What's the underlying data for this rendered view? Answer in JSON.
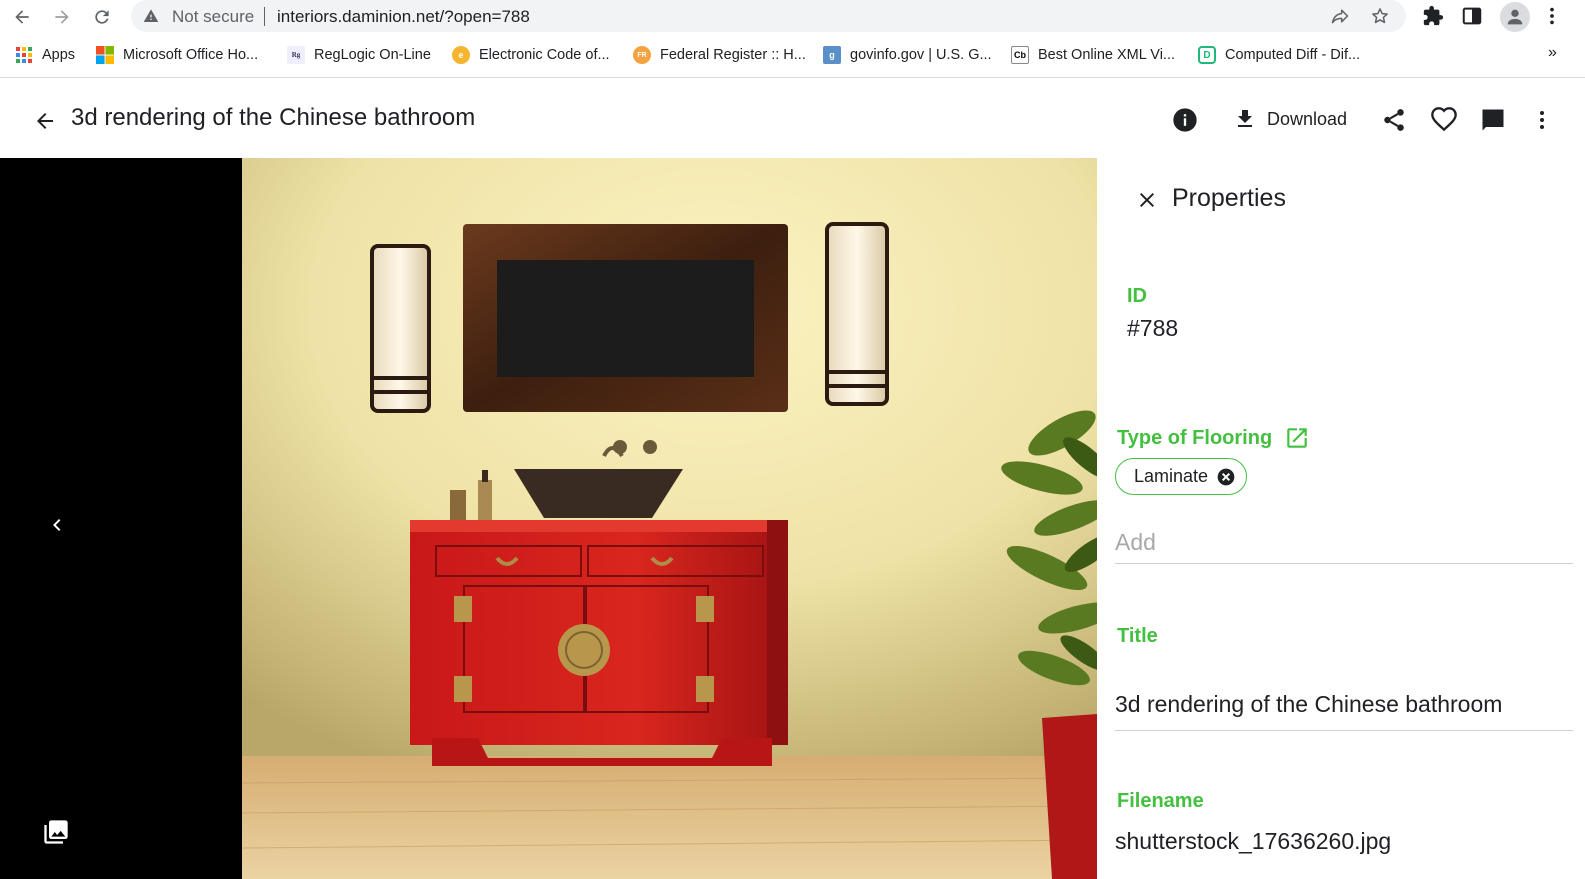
{
  "browser": {
    "security_label": "Not secure",
    "url": "interiors.daminion.net/?open=788",
    "bookmarks": [
      {
        "label": "Apps",
        "icon": "apps-grid-icon"
      },
      {
        "label": "Microsoft Office Ho...",
        "icon": "microsoft-logo-icon"
      },
      {
        "label": "RegLogic On-Line",
        "icon": "reglogic-icon"
      },
      {
        "label": "Electronic Code of...",
        "icon": "ecfr-icon"
      },
      {
        "label": "Federal Register :: H...",
        "icon": "federal-register-icon"
      },
      {
        "label": "govinfo.gov | U.S. G...",
        "icon": "govinfo-icon"
      },
      {
        "label": "Best Online XML Vi...",
        "icon": "codebeautify-icon"
      },
      {
        "label": "Computed Diff - Dif...",
        "icon": "diff-icon"
      }
    ],
    "overflow_label": "»"
  },
  "app": {
    "title": "3d rendering of the Chinese bathroom",
    "download_label": "Download"
  },
  "properties": {
    "heading": "Properties",
    "id_label": "ID",
    "id_value": "#788",
    "flooring_label": "Type of Flooring",
    "flooring_tag": "Laminate",
    "flooring_add_placeholder": "Add",
    "title_label": "Title",
    "title_value": "3d rendering of the Chinese bathroom",
    "filename_label": "Filename",
    "filename_value": "shutterstock_17636260.jpg"
  },
  "colors": {
    "accent_green": "#43c040",
    "viewer_bg": "#000000",
    "omnibox_bg": "#f1f3f4"
  }
}
